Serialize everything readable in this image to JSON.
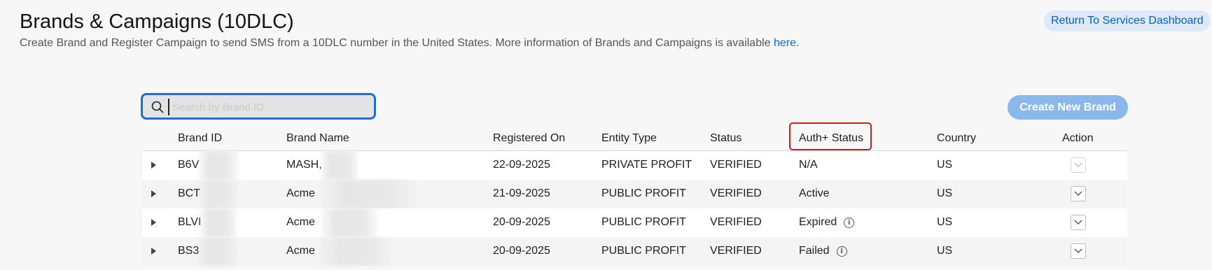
{
  "header": {
    "title": "Brands & Campaigns (10DLC)",
    "subtitle": "Create Brand and Register Campaign to send SMS from a 10DLC number in the United States. More information of Brands and Campaigns is available ",
    "subtitle_link": "here.",
    "return_link": "Return To Services Dashboard"
  },
  "search": {
    "placeholder": "Search by Brand ID",
    "icon": "search-icon"
  },
  "create_button": "Create New Brand",
  "table": {
    "columns": [
      "Brand ID",
      "Brand Name",
      "Registered On",
      "Entity Type",
      "Status",
      "Auth+ Status",
      "Country",
      "Action"
    ],
    "rows": [
      {
        "brand_id": "B6V",
        "brand_name": "MASH,",
        "registered_on": "22-09-2025",
        "entity_type": "PRIVATE PROFIT",
        "status": "VERIFIED",
        "auth_status": "N/A",
        "auth_info": false,
        "country": "US"
      },
      {
        "brand_id": "BCT",
        "brand_name": "Acme",
        "registered_on": "21-09-2025",
        "entity_type": "PUBLIC PROFIT",
        "status": "VERIFIED",
        "auth_status": "Active",
        "auth_info": false,
        "country": "US"
      },
      {
        "brand_id": "BLVI",
        "brand_name": "Acme",
        "registered_on": "20-09-2025",
        "entity_type": "PUBLIC PROFIT",
        "status": "VERIFIED",
        "auth_status": "Expired",
        "auth_info": true,
        "country": "US"
      },
      {
        "brand_id": "BS3",
        "brand_name": "Acme",
        "registered_on": "20-09-2025",
        "entity_type": "PUBLIC PROFIT",
        "status": "VERIFIED",
        "auth_status": "Failed",
        "auth_info": true,
        "country": "US"
      }
    ]
  },
  "colors": {
    "accent": "#1d6fd6",
    "highlight_box": "#d01b1b",
    "button_bg": "#8bb8ea"
  }
}
